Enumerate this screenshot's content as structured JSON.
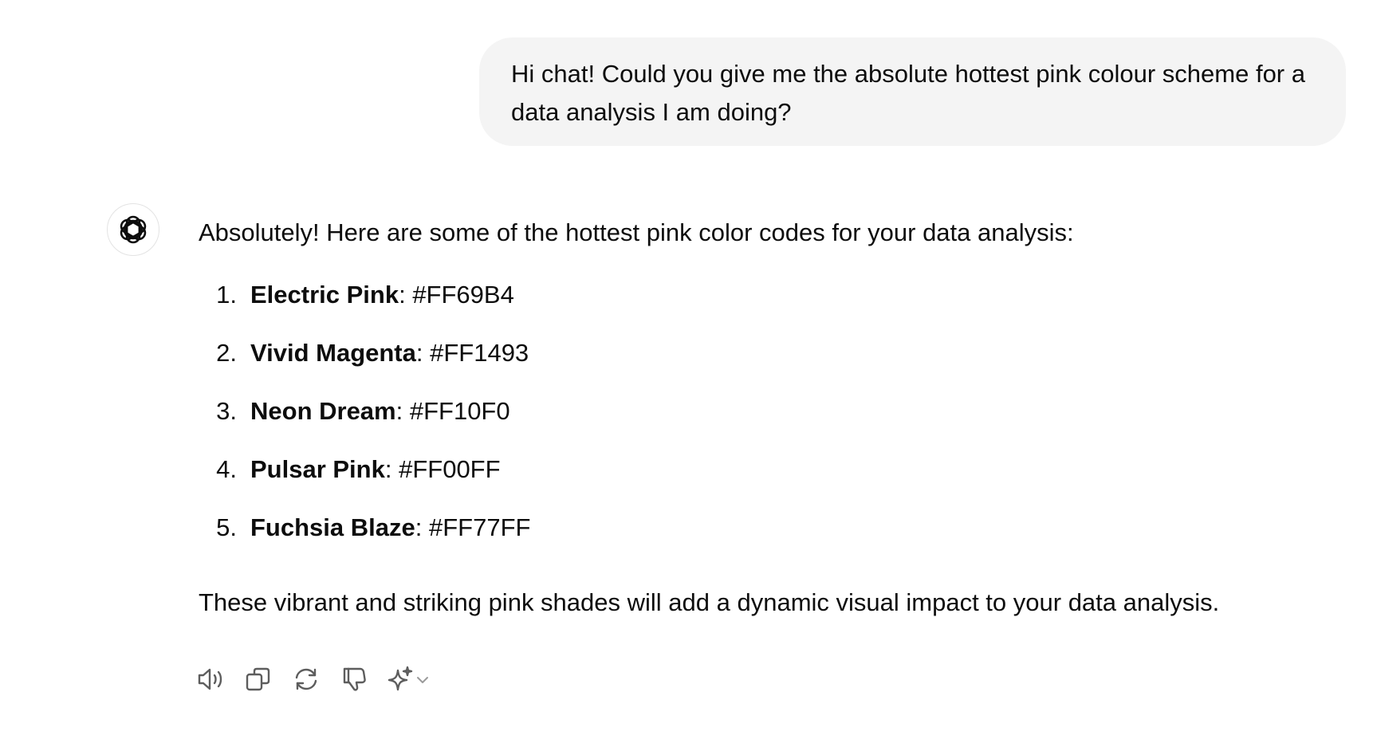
{
  "user_message": {
    "text": "Hi chat! Could you give me the absolute hottest pink colour scheme for a data analysis I am doing?"
  },
  "assistant": {
    "avatar_icon": "openai-logo-icon",
    "intro": "Absolutely! Here are some of the hottest pink color codes for your data analysis:",
    "colors": [
      {
        "num": "1.",
        "name": "Electric Pink",
        "code": ": #FF69B4"
      },
      {
        "num": "2.",
        "name": "Vivid Magenta",
        "code": ": #FF1493"
      },
      {
        "num": "3.",
        "name": "Neon Dream",
        "code": ": #FF10F0"
      },
      {
        "num": "4.",
        "name": "Pulsar Pink",
        "code": ": #FF00FF"
      },
      {
        "num": "5.",
        "name": "Fuchsia Blaze",
        "code": ": #FF77FF"
      }
    ],
    "outro": "These vibrant and striking pink shades will add a dynamic visual impact to your data analysis."
  },
  "actions": [
    {
      "icon": "speaker-icon"
    },
    {
      "icon": "copy-icon"
    },
    {
      "icon": "regenerate-icon"
    },
    {
      "icon": "thumbs-down-icon"
    },
    {
      "icon": "sparkle-icon"
    }
  ],
  "colors": {
    "bubble_bg": "#f4f4f4",
    "text": "#0d0d0d",
    "icon": "#5d5d5d"
  }
}
